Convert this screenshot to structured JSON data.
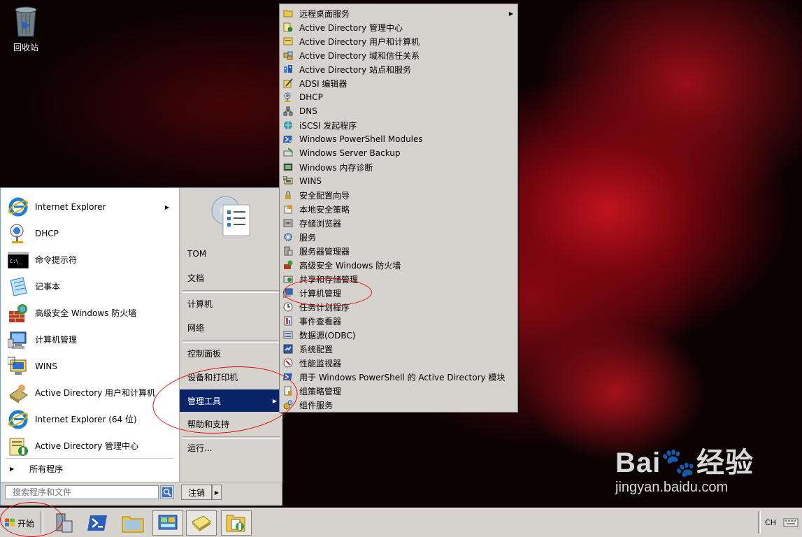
{
  "desktop": {
    "recycle_bin": {
      "label": "回收站",
      "icon": "recycle-bin-icon"
    },
    "watermark": {
      "logo": "Bai🐾经验",
      "url": "jingyan.baidu.com"
    }
  },
  "start_menu": {
    "pinned": [
      {
        "label": "Internet Explorer",
        "icon": "internet-explorer-icon",
        "has_submenu": true
      },
      {
        "label": "DHCP",
        "icon": "dhcp-icon"
      },
      {
        "label": "命令提示符",
        "icon": "command-prompt-icon"
      },
      {
        "label": "记事本",
        "icon": "notepad-icon"
      },
      {
        "label": "高级安全 Windows 防火墙",
        "icon": "firewall-icon"
      },
      {
        "label": "计算机管理",
        "icon": "computer-management-icon"
      },
      {
        "label": "WINS",
        "icon": "wins-icon"
      },
      {
        "label": "Active Directory 用户和计算机",
        "icon": "ad-users-computers-icon"
      },
      {
        "label": "Internet Explorer (64 位)",
        "icon": "internet-explorer-icon"
      },
      {
        "label": "Active Directory 管理中心",
        "icon": "ad-admin-center-icon"
      }
    ],
    "all_programs": "所有程序",
    "user": "TOM",
    "right": {
      "documents": "文档",
      "computer": "计算机",
      "network": "网络",
      "control_panel": "控制面板",
      "devices_printers": "设备和打印机",
      "admin_tools": "管理工具",
      "help_support": "帮助和支持",
      "run": "运行..."
    },
    "search_placeholder": "搜索程序和文件",
    "logoff": "注销"
  },
  "admin_tools": [
    {
      "label": "远程桌面服务",
      "icon": "folder-icon",
      "has_submenu": true
    },
    {
      "label": "Active Directory 管理中心",
      "icon": "ad-admin-center-icon"
    },
    {
      "label": "Active Directory 用户和计算机",
      "icon": "ad-users-computers-icon"
    },
    {
      "label": "Active Directory 域和信任关系",
      "icon": "ad-domains-trusts-icon"
    },
    {
      "label": "Active Directory 站点和服务",
      "icon": "ad-sites-services-icon"
    },
    {
      "label": "ADSI 编辑器",
      "icon": "adsi-edit-icon"
    },
    {
      "label": "DHCP",
      "icon": "dhcp-icon"
    },
    {
      "label": "DNS",
      "icon": "dns-icon"
    },
    {
      "label": "iSCSI 发起程序",
      "icon": "iscsi-icon"
    },
    {
      "label": "Windows PowerShell Modules",
      "icon": "powershell-icon"
    },
    {
      "label": "Windows Server Backup",
      "icon": "backup-icon"
    },
    {
      "label": "Windows 内存诊断",
      "icon": "memory-diagnostic-icon"
    },
    {
      "label": "WINS",
      "icon": "wins-icon"
    },
    {
      "label": "安全配置向导",
      "icon": "security-wizard-icon"
    },
    {
      "label": "本地安全策略",
      "icon": "local-security-policy-icon"
    },
    {
      "label": "存储浏览器",
      "icon": "storage-explorer-icon"
    },
    {
      "label": "服务",
      "icon": "services-icon"
    },
    {
      "label": "服务器管理器",
      "icon": "server-manager-icon"
    },
    {
      "label": "高级安全 Windows 防火墙",
      "icon": "firewall-icon"
    },
    {
      "label": "共享和存储管理",
      "icon": "share-storage-icon"
    },
    {
      "label": "计算机管理",
      "icon": "computer-management-icon"
    },
    {
      "label": "任务计划程序",
      "icon": "task-scheduler-icon"
    },
    {
      "label": "事件查看器",
      "icon": "event-viewer-icon"
    },
    {
      "label": "数据源(ODBC)",
      "icon": "odbc-icon"
    },
    {
      "label": "系统配置",
      "icon": "system-config-icon"
    },
    {
      "label": "性能监视器",
      "icon": "performance-monitor-icon"
    },
    {
      "label": "用于 Windows PowerShell 的 Active Directory 模块",
      "icon": "powershell-ad-icon"
    },
    {
      "label": "组策略管理",
      "icon": "group-policy-icon"
    },
    {
      "label": "组件服务",
      "icon": "component-services-icon"
    }
  ],
  "taskbar": {
    "start_label": "开始",
    "quick_launch": [
      {
        "icon": "server-manager-icon"
      },
      {
        "icon": "powershell-icon"
      },
      {
        "icon": "explorer-folder-icon"
      },
      {
        "icon": "control-panel-icon"
      },
      {
        "icon": "notepad-icon"
      },
      {
        "icon": "admin-tools-icon"
      }
    ],
    "language": "CH"
  },
  "colors": {
    "selection": "#0a246a",
    "menu_bg": "#d6d3ce",
    "annotation": "#e01010"
  }
}
